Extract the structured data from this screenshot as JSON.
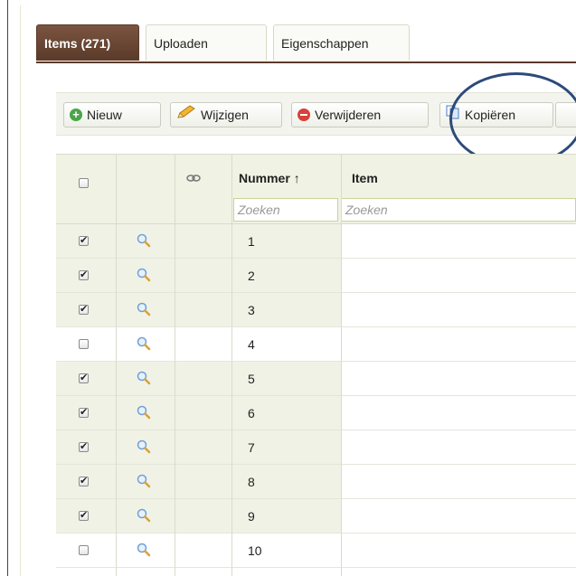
{
  "tabs": [
    {
      "label": "Items (271)",
      "active": true
    },
    {
      "label": "Uploaden",
      "active": false
    },
    {
      "label": "Eigenschappen",
      "active": false
    }
  ],
  "toolbar": {
    "new_label": "Nieuw",
    "edit_label": "Wijzigen",
    "delete_label": "Verwijderen",
    "copy_label": "Kopiëren"
  },
  "grid": {
    "columns": {
      "nummer": "Nummer",
      "nummer_sort": "↑",
      "item": "Item"
    },
    "search_placeholder_nummer": "Zoeken",
    "search_placeholder_item": "Zoeken",
    "rows": [
      {
        "number": "1",
        "checked": true
      },
      {
        "number": "2",
        "checked": true
      },
      {
        "number": "3",
        "checked": true
      },
      {
        "number": "4",
        "checked": false
      },
      {
        "number": "5",
        "checked": true
      },
      {
        "number": "6",
        "checked": true
      },
      {
        "number": "7",
        "checked": true
      },
      {
        "number": "8",
        "checked": true
      },
      {
        "number": "9",
        "checked": true
      },
      {
        "number": "10",
        "checked": false
      }
    ]
  },
  "colors": {
    "active_tab": "#5b3a2a",
    "highlight_circle": "#2d4a7a",
    "row_shade": "#f1f2e6"
  }
}
